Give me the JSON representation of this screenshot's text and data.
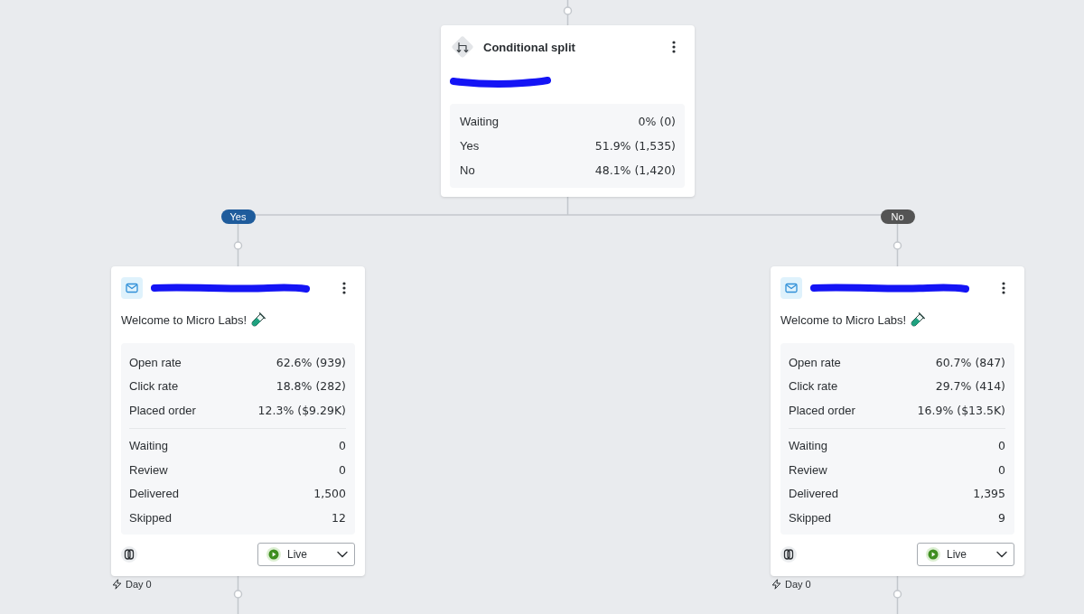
{
  "split_node": {
    "title": "Conditional split",
    "subtitle_redacted": true,
    "stats": [
      {
        "label": "Waiting",
        "value": "0% (0)"
      },
      {
        "label": "Yes",
        "value": "51.9% (1,535)"
      },
      {
        "label": "No",
        "value": "48.1% (1,420)"
      }
    ]
  },
  "branches": [
    {
      "label": "Yes",
      "color": "#1f5c9c",
      "email_node": {
        "title_redacted": true,
        "subject": "Welcome to Micro Labs!",
        "metrics": [
          {
            "label": "Open rate",
            "value": "62.6% (939)"
          },
          {
            "label": "Click rate",
            "value": "18.8% (282)"
          },
          {
            "label": "Placed order",
            "value": "12.3% ($9.29K)"
          }
        ],
        "counts": [
          {
            "label": "Waiting",
            "value": "0"
          },
          {
            "label": "Review",
            "value": "0"
          },
          {
            "label": "Delivered",
            "value": "1,500"
          },
          {
            "label": "Skipped",
            "value": "12"
          }
        ],
        "status": "Live",
        "delay": "Day 0"
      }
    },
    {
      "label": "No",
      "color": "#545454",
      "email_node": {
        "title_redacted": true,
        "subject": "Welcome to Micro Labs!",
        "metrics": [
          {
            "label": "Open rate",
            "value": "60.7% (847)"
          },
          {
            "label": "Click rate",
            "value": "29.7% (414)"
          },
          {
            "label": "Placed order",
            "value": "16.9% ($13.5K)"
          }
        ],
        "counts": [
          {
            "label": "Waiting",
            "value": "0"
          },
          {
            "label": "Review",
            "value": "0"
          },
          {
            "label": "Delivered",
            "value": "1,395"
          },
          {
            "label": "Skipped",
            "value": "9"
          }
        ],
        "status": "Live",
        "delay": "Day 0"
      }
    }
  ]
}
